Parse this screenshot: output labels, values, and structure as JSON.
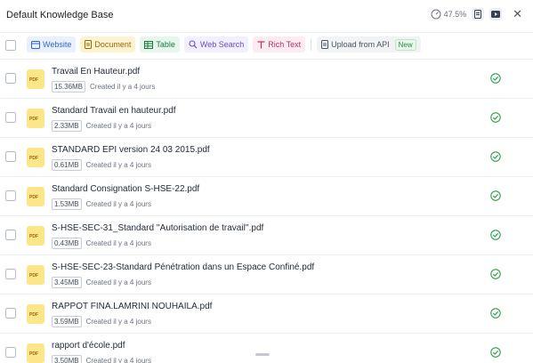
{
  "header": {
    "title": "Default Knowledge Base",
    "usage_percent": "47.5%",
    "doc_icon": "document-icon",
    "video_icon": "video-icon",
    "close_glyph": "✕"
  },
  "toolbar": {
    "chips": [
      {
        "label": "Website",
        "icon": "globe-icon",
        "color": "#2f67d6"
      },
      {
        "label": "Document",
        "icon": "document-icon",
        "color": "#9a6a00"
      },
      {
        "label": "Table",
        "icon": "table-icon",
        "color": "#1f7a40"
      },
      {
        "label": "Web Search",
        "icon": "search-icon",
        "color": "#6d4ac9"
      },
      {
        "label": "Rich Text",
        "icon": "text-icon",
        "color": "#b0336a"
      }
    ],
    "upload": {
      "label": "Upload from API",
      "badge": "New"
    }
  },
  "file_type_label": "PDF",
  "files": [
    {
      "name": "Travail En Hauteur.pdf",
      "size": "15.36MB",
      "created": "Created il y a 4 jours"
    },
    {
      "name": "Standard Travail en hauteur.pdf",
      "size": "2.33MB",
      "created": "Created il y a 4 jours"
    },
    {
      "name": "STANDARD EPI version 24 03 2015.pdf",
      "size": "0.61MB",
      "created": "Created il y a 4 jours"
    },
    {
      "name": "Standard Consignation S-HSE-22.pdf",
      "size": "1.53MB",
      "created": "Created il y a 4 jours"
    },
    {
      "name": "S-HSE-SEC-31_Standard ''Autorisation de travail''.pdf",
      "size": "0.43MB",
      "created": "Created il y a 4 jours"
    },
    {
      "name": "S-HSE-SEC-23-Standard Pénétration dans un Espace Confiné.pdf",
      "size": "3.45MB",
      "created": "Created il y a 4 jours"
    },
    {
      "name": "RAPPOT FINA.LAMRINI NOUHAILA.pdf",
      "size": "3.59MB",
      "created": "Created il y a 4 jours"
    },
    {
      "name": "rapport d'école.pdf",
      "size": "3.50MB",
      "created": "Created il y a 4 jours"
    }
  ],
  "colors": {
    "status_ok": "#2f9e4f",
    "file_icon_bg": "#fde68a"
  }
}
